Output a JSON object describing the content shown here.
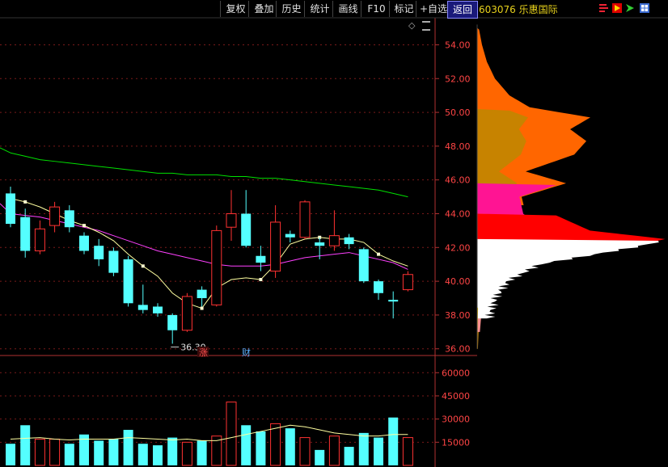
{
  "toolbar": {
    "buttons": [
      {
        "id": "fuquan",
        "label": "复权"
      },
      {
        "id": "diejia",
        "label": "叠加"
      },
      {
        "id": "lishi",
        "label": "历史"
      },
      {
        "id": "tongji",
        "label": "统计"
      },
      {
        "id": "huaxian",
        "label": "画线"
      },
      {
        "id": "f10",
        "label": "F10"
      },
      {
        "id": "biaoji",
        "label": "标记"
      },
      {
        "id": "zixuan",
        "label": "+自选"
      },
      {
        "id": "fanhui",
        "label": "返回"
      }
    ],
    "stock_label": "603076 乐惠国际",
    "icons": [
      "bars-icon",
      "flag-icon",
      "arrow-icon",
      "grid-icon"
    ]
  },
  "price_axis": {
    "ticks": [
      "54.00",
      "52.00",
      "50.00",
      "48.00",
      "46.00",
      "44.00",
      "42.00",
      "40.00",
      "38.00",
      "36.00"
    ],
    "values": [
      54,
      52,
      50,
      48,
      46,
      44,
      42,
      40,
      38,
      36
    ]
  },
  "volume_axis": {
    "ticks": [
      "60000",
      "45000",
      "30000",
      "15000"
    ],
    "values": [
      60000,
      45000,
      30000,
      15000
    ]
  },
  "annotations": {
    "low_label": "36.30",
    "marker_zhang": "涨",
    "marker_cai": "财"
  },
  "colors": {
    "up": "#ff3232",
    "down": "#54ffff",
    "ma5": "#ffffa0",
    "ma10": "#ff40ff",
    "ma60": "#00e000",
    "grid": "#7a1a1a",
    "axis": "#b03030",
    "text": "#ff4545"
  },
  "chart_data": {
    "type": "candlestick",
    "candles": [
      {
        "o": 45.2,
        "c": 43.4,
        "h": 45.6,
        "l": 43.2,
        "v": 14000
      },
      {
        "o": 43.8,
        "c": 41.8,
        "h": 44.3,
        "l": 41.4,
        "v": 26000
      },
      {
        "o": 41.8,
        "c": 43.1,
        "h": 43.6,
        "l": 41.6,
        "v": 17000
      },
      {
        "o": 43.3,
        "c": 44.4,
        "h": 44.7,
        "l": 42.9,
        "v": 17000
      },
      {
        "o": 44.2,
        "c": 43.2,
        "h": 44.5,
        "l": 42.9,
        "v": 14000
      },
      {
        "o": 42.7,
        "c": 41.8,
        "h": 42.9,
        "l": 41.6,
        "v": 20000
      },
      {
        "o": 42.1,
        "c": 41.3,
        "h": 42.5,
        "l": 40.9,
        "v": 16000
      },
      {
        "o": 41.8,
        "c": 40.5,
        "h": 42.0,
        "l": 40.3,
        "v": 17000
      },
      {
        "o": 41.3,
        "c": 38.7,
        "h": 41.5,
        "l": 38.5,
        "v": 23000
      },
      {
        "o": 38.6,
        "c": 38.3,
        "h": 39.8,
        "l": 38.1,
        "v": 14000
      },
      {
        "o": 38.5,
        "c": 38.1,
        "h": 38.7,
        "l": 37.9,
        "v": 13000
      },
      {
        "o": 38.0,
        "c": 37.1,
        "h": 38.1,
        "l": 36.3,
        "v": 18000
      },
      {
        "o": 37.1,
        "c": 39.1,
        "h": 39.3,
        "l": 37.0,
        "v": 15000
      },
      {
        "o": 39.5,
        "c": 39.0,
        "h": 39.7,
        "l": 38.5,
        "v": 16000
      },
      {
        "o": 38.6,
        "c": 43.0,
        "h": 43.3,
        "l": 38.5,
        "v": 19000
      },
      {
        "o": 43.2,
        "c": 44.0,
        "h": 45.4,
        "l": 42.4,
        "v": 41000
      },
      {
        "o": 44.0,
        "c": 42.1,
        "h": 45.4,
        "l": 42.0,
        "v": 26000
      },
      {
        "o": 41.5,
        "c": 41.1,
        "h": 42.1,
        "l": 40.6,
        "v": 22000
      },
      {
        "o": 40.6,
        "c": 43.5,
        "h": 44.5,
        "l": 40.2,
        "v": 27000
      },
      {
        "o": 42.8,
        "c": 42.6,
        "h": 43.0,
        "l": 42.3,
        "v": 24000
      },
      {
        "o": 42.6,
        "c": 44.7,
        "h": 44.8,
        "l": 42.5,
        "v": 18000
      },
      {
        "o": 42.3,
        "c": 42.1,
        "h": 42.6,
        "l": 41.3,
        "v": 10000
      },
      {
        "o": 42.1,
        "c": 42.7,
        "h": 44.2,
        "l": 41.8,
        "v": 19000
      },
      {
        "o": 42.6,
        "c": 42.2,
        "h": 42.8,
        "l": 41.9,
        "v": 12000
      },
      {
        "o": 41.9,
        "c": 40.0,
        "h": 42.0,
        "l": 39.9,
        "v": 21000
      },
      {
        "o": 40.0,
        "c": 39.3,
        "h": 40.1,
        "l": 38.9,
        "v": 18000
      },
      {
        "o": 38.9,
        "c": 38.8,
        "h": 39.4,
        "l": 37.8,
        "v": 31000
      },
      {
        "o": 39.5,
        "c": 40.4,
        "h": 40.6,
        "l": 39.4,
        "v": 18000
      }
    ],
    "ma5": [
      44.9,
      44.7,
      44.4,
      44.0,
      43.6,
      43.3,
      42.9,
      42.4,
      41.6,
      40.9,
      40.3,
      39.3,
      38.7,
      38.4,
      39.6,
      40.1,
      40.2,
      40.1,
      41.0,
      42.2,
      42.5,
      42.6,
      42.5,
      42.5,
      42.3,
      41.6,
      41.2,
      40.9
    ],
    "ma10": [
      44.0,
      43.9,
      43.8,
      43.6,
      43.4,
      43.2,
      43.0,
      42.7,
      42.4,
      42.1,
      41.8,
      41.6,
      41.4,
      41.2,
      41.0,
      40.9,
      40.9,
      40.9,
      41.0,
      41.2,
      41.4,
      41.5,
      41.6,
      41.7,
      41.5,
      41.3,
      41.1,
      40.7
    ],
    "ma60": [
      47.6,
      47.4,
      47.2,
      47.1,
      47.0,
      46.9,
      46.8,
      46.7,
      46.6,
      46.5,
      46.4,
      46.4,
      46.3,
      46.3,
      46.3,
      46.2,
      46.2,
      46.1,
      46.1,
      46.0,
      45.9,
      45.8,
      45.7,
      45.6,
      45.5,
      45.4,
      45.2,
      45.0
    ],
    "vol_ma": [
      17000,
      17500,
      18000,
      17000,
      16500,
      17000,
      17000,
      17000,
      18000,
      17500,
      17000,
      16500,
      17000,
      16000,
      16000,
      18000,
      20000,
      22000,
      24000,
      26000,
      25000,
      23000,
      21000,
      20000,
      19000,
      19000,
      20000,
      20000
    ],
    "price_range": [
      35.7,
      55.6
    ],
    "volume_range": [
      0,
      68000
    ],
    "chip_dist": {
      "outer_profile": [
        [
          36,
          2
        ],
        [
          37,
          4
        ],
        [
          38,
          6
        ],
        [
          39,
          10
        ],
        [
          40,
          20
        ],
        [
          41,
          45
        ],
        [
          42,
          120
        ],
        [
          42.5,
          150
        ],
        [
          43,
          90
        ],
        [
          44,
          60
        ],
        [
          45,
          55
        ],
        [
          45.8,
          110
        ],
        [
          46.5,
          60
        ],
        [
          47.5,
          120
        ],
        [
          48.3,
          135
        ],
        [
          49,
          115
        ],
        [
          49.7,
          140
        ],
        [
          50.3,
          65
        ],
        [
          51,
          40
        ],
        [
          52,
          22
        ],
        [
          53,
          12
        ],
        [
          54,
          6
        ],
        [
          55,
          2
        ]
      ],
      "layers": [
        {
          "color": "#ff6600",
          "top": 55.0,
          "bottom": 44.5
        },
        {
          "color": "#c78300",
          "top": 50.2,
          "bottom": 36.0
        },
        {
          "color": "#ff1493",
          "top": 45.8,
          "bottom": 41.0
        },
        {
          "color": "#ff9090",
          "top": 44.0,
          "bottom": 37.0
        },
        {
          "color": "#ff0000",
          "top": 44.0,
          "bottom": 41.0
        },
        {
          "color": "#ffffff",
          "top": 42.5,
          "bottom": 37.8
        },
        {
          "color": "#ffd000",
          "top": 38.5,
          "bottom": 36.0
        }
      ]
    }
  }
}
